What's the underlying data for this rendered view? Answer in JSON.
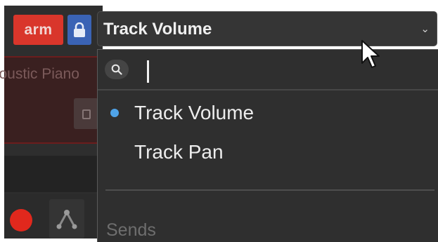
{
  "track": {
    "arm_label": "arm",
    "instrument_name": "Acoustic Piano"
  },
  "parameter_selector": {
    "selected": "Track Volume",
    "chevron": "chevron-down-icon"
  },
  "dropdown": {
    "search": {
      "value": "",
      "placeholder": ""
    },
    "items": [
      {
        "label": "Track Volume",
        "selected": true
      },
      {
        "label": "Track Pan",
        "selected": false
      }
    ],
    "sections": [
      {
        "label": "Sends"
      }
    ]
  },
  "colors": {
    "arm": "#d9362b",
    "lock": "#3a63b5",
    "record": "#e1281d",
    "selected_dot": "#4fa3e8",
    "panel": "#2f2f2f"
  }
}
